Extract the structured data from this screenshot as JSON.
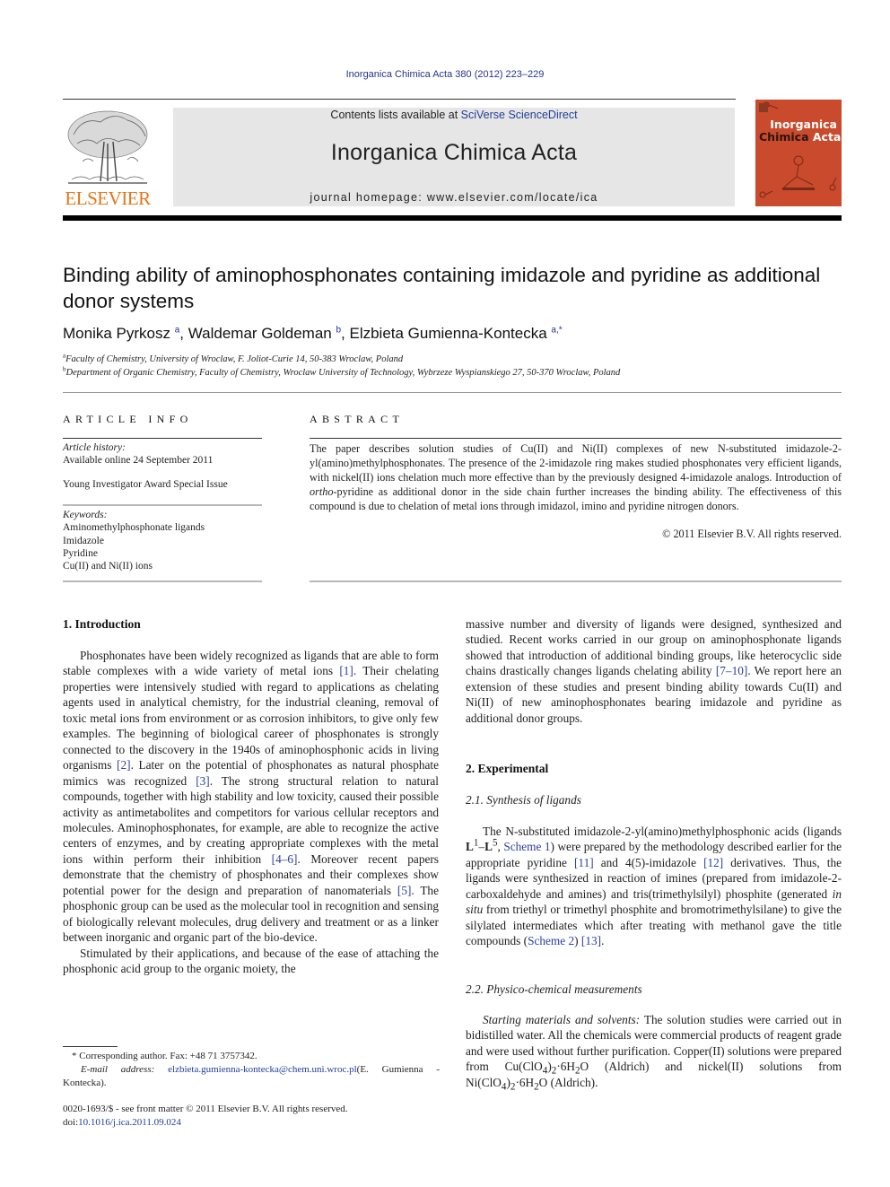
{
  "header": {
    "journal_ref": "Inorganica Chimica Acta 380 (2012) 223–229",
    "contents_prefix": "Contents lists available at ",
    "contents_link": "SciVerse ScienceDirect",
    "journal_name": "Inorganica Chimica Acta",
    "homepage": "journal homepage: www.elsevier.com/locate/ica",
    "publisher_logo_text": "ELSEVIER",
    "publisher_color": "#e2761a",
    "cover": {
      "line1": "Inorganica",
      "line2a": "Chimica",
      "line2b": "Acta",
      "color": "#c94a2c"
    }
  },
  "article": {
    "title": "Binding ability of aminophosphonates containing imidazole and pyridine as additional donor systems",
    "authors": [
      {
        "name": "Monika Pyrkosz",
        "sup": "a"
      },
      {
        "name": "Waldemar Goldeman",
        "sup": "b"
      },
      {
        "name": "Elzbieta Gumienna-Kontecka",
        "sup": "a,*"
      }
    ],
    "affiliations": [
      {
        "mark": "a",
        "text": "Faculty of Chemistry, University of Wroclaw, F. Joliot-Curie 14, 50-383 Wroclaw, Poland"
      },
      {
        "mark": "b",
        "text": "Department of Organic Chemistry, Faculty of Chemistry, Wroclaw University of Technology, Wybrzeze Wyspianskiego 27, 50-370 Wroclaw, Poland"
      }
    ]
  },
  "article_info": {
    "heading": "ARTICLE INFO",
    "history_label": "Article history:",
    "history_value": "Available online 24 September 2011",
    "special_issue": "Young Investigator Award Special Issue",
    "keywords_label": "Keywords:",
    "keywords": [
      "Aminomethylphosphonate ligands",
      "Imidazole",
      "Pyridine",
      "Cu(II) and Ni(II) ions"
    ]
  },
  "abstract": {
    "heading": "ABSTRACT",
    "part1": "The paper describes solution studies of Cu(II) and Ni(II) complexes of new N-substituted imidazole-2-yl(amino)methylphosphonates. The presence of the 2-imidazole ring makes studied phosphonates very efficient ligands, with nickel(II) ions chelation much more effective than by the previously designed 4-imidazole analogs. Introduction of ",
    "italic": "ortho",
    "part2": "-pyridine as additional donor in the side chain further increases the binding ability. The effectiveness of this compound is due to chelation of metal ions through imidazol, imino and pyridine nitrogen donors.",
    "copyright": "© 2011 Elsevier B.V. All rights reserved."
  },
  "intro": {
    "heading": "1. Introduction",
    "p1": [
      {
        "t": "Phosphonates have been widely recognized as ligands that are able to form stable complexes with a wide variety of metal ions "
      },
      {
        "ref": "[1]"
      },
      {
        "t": ". Their chelating properties were intensively studied with regard to applications as chelating agents used in analytical chemistry, for the industrial cleaning, removal of toxic metal ions from environment or as corrosion inhibitors, to give only few examples. The beginning of biological career of phosphonates is strongly connected to the discovery in the 1940s of aminophosphonic acids in living organisms "
      },
      {
        "ref": "[2]"
      },
      {
        "t": ". Later on the potential of phosphonates as natural phosphate mimics was recognized "
      },
      {
        "ref": "[3]"
      },
      {
        "t": ". The strong structural relation to natural compounds, together with high stability and low toxicity, caused their possible activity as antimetabolites and competitors for various cellular receptors and molecules. Aminophosphonates, for example, are able to recognize the active centers of enzymes, and by creating appropriate complexes with the metal ions within perform their inhibition "
      },
      {
        "ref": "[4–6]"
      },
      {
        "t": ". Moreover recent papers demonstrate that the chemistry of phosphonates and their complexes show potential power for the design and preparation of nanomaterials "
      },
      {
        "ref": "[5]"
      },
      {
        "t": ". The phosphonic group can be used as the molecular tool in recognition and sensing of biologically relevant molecules, drug delivery and treatment or as a linker between inorganic and organic part of the bio-device."
      }
    ],
    "p2_left": "Stimulated by their applications, and because of the ease of attaching the phosphonic acid group to the organic moiety, the",
    "p2_right": [
      {
        "t": "massive number and diversity of ligands were designed, synthesized and studied. Recent works carried in our group on aminophosphonate ligands showed that introduction of additional binding groups, like heterocyclic side chains drastically changes ligands chelating ability "
      },
      {
        "ref": "[7–10]"
      },
      {
        "t": ". We report here an extension of these studies and present binding ability towards Cu(II) and Ni(II) of new aminophosphonates bearing imidazole and pyridine as additional donor groups."
      }
    ]
  },
  "experimental": {
    "heading": "2. Experimental",
    "sub1_heading": "2.1. Synthesis of ligands",
    "sub1_parts": {
      "a": "The N-substituted imidazole-2-yl(amino)methylphosphonic acids (ligands ",
      "L": "L",
      "sup1": "1",
      "dash": "–",
      "sup5": "5",
      "comma": ", ",
      "scheme1": "Scheme 1",
      "b": ") were prepared by the methodology described earlier for the appropriate pyridine ",
      "ref11": "[11]",
      "c": " and 4(5)-imidazole ",
      "ref12": "[12]",
      "d": " derivatives. Thus, the ligands were synthesized in reaction of imines (prepared from imidazole-2-carboxaldehyde and amines) and tris(trimethylsilyl) phosphite (generated ",
      "insitu": "in situ",
      "e": " from triethyl or trimethyl phosphite and bromotrimethylsilane) to give the silylated intermediates which after treating with methanol gave the title compounds (",
      "scheme2": "Scheme 2",
      "f": ") ",
      "ref13": "[13]",
      "g": "."
    },
    "sub2_heading": "2.2. Physico-chemical measurements",
    "sub2_parts": {
      "lead": "Starting materials and solvents:",
      "a": " The solution studies were carried out in bidistilled water. All the chemicals were commercial products of reagent grade and were used without further purification. Copper(II) solutions were prepared from Cu(ClO",
      "s4": "4",
      "b": ")",
      "s2": "2",
      "c": "·6H",
      "s2b": "2",
      "d": "O (Aldrich) and nickel(II) solutions from Ni(ClO",
      "s4b": "4",
      "e": ")",
      "s2c": "2",
      "f": "·6H",
      "s2d": "2",
      "g": "O (Aldrich)."
    }
  },
  "footnotes": {
    "corr_mark": "*",
    "corr_text": " Corresponding author. Fax: +48 71 3757342.",
    "email_label": "E-mail address:",
    "email": "elzbieta.gumienna-kontecka@chem.uni.wroc.pl",
    "email_after": "(E. Gumienna -Kontecka).",
    "front_matter": "0020-1693/$ - see front matter © 2011 Elsevier B.V. All rights reserved.",
    "doi_label": "doi:",
    "doi": "10.1016/j.ica.2011.09.024"
  }
}
